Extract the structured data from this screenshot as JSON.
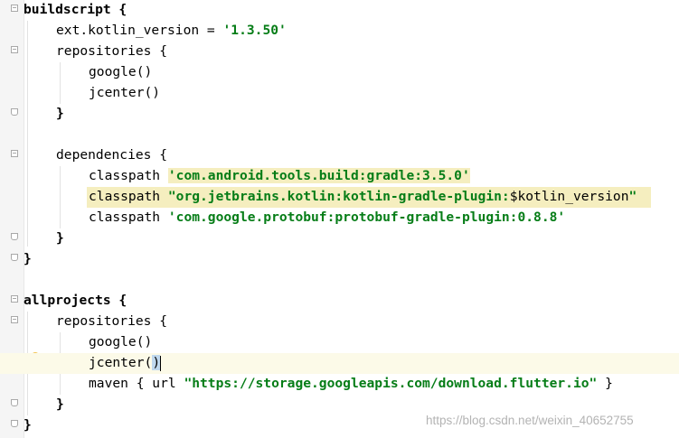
{
  "editor": {
    "lines": [
      {
        "tokens": [
          {
            "t": "buildscript {",
            "c": "kw"
          }
        ]
      },
      {
        "tokens": [
          {
            "t": "ext.kotlin_version = ",
            "c": ""
          },
          {
            "t": "'1.3.50'",
            "c": "str"
          }
        ]
      },
      {
        "tokens": [
          {
            "t": "repositories {",
            "c": ""
          }
        ]
      },
      {
        "tokens": [
          {
            "t": "google()",
            "c": ""
          }
        ]
      },
      {
        "tokens": [
          {
            "t": "jcenter()",
            "c": ""
          }
        ]
      },
      {
        "tokens": [
          {
            "t": "}",
            "c": "kw"
          }
        ]
      },
      {
        "tokens": []
      },
      {
        "tokens": [
          {
            "t": "dependencies {",
            "c": ""
          }
        ]
      },
      {
        "tokens": [
          {
            "t": "classpath ",
            "c": ""
          },
          {
            "t": "'com.android.tools.build:gradle:3.5.0'",
            "c": "str hl"
          }
        ]
      },
      {
        "tokens": [
          {
            "t": "classpath ",
            "c": ""
          },
          {
            "t": "\"org.jetbrains.kotlin:kotlin-gradle-plugin:",
            "c": "str"
          },
          {
            "t": "$kotlin_version",
            "c": ""
          },
          {
            "t": "\"",
            "c": "str"
          }
        ]
      },
      {
        "tokens": [
          {
            "t": "classpath ",
            "c": ""
          },
          {
            "t": "'com.google.protobuf:protobuf-gradle-plugin:0.8.8'",
            "c": "str"
          }
        ]
      },
      {
        "tokens": [
          {
            "t": "}",
            "c": "kw"
          }
        ]
      },
      {
        "tokens": [
          {
            "t": "}",
            "c": "kw"
          }
        ]
      },
      {
        "tokens": []
      },
      {
        "tokens": [
          {
            "t": "allprojects {",
            "c": "kw"
          }
        ]
      },
      {
        "tokens": [
          {
            "t": "repositories {",
            "c": ""
          }
        ]
      },
      {
        "tokens": [
          {
            "t": "google()",
            "c": ""
          }
        ]
      },
      {
        "tokens": [
          {
            "t": "jcenter",
            "c": ""
          },
          {
            "t": "(",
            "c": ""
          },
          {
            "t": ")",
            "c": "brace-hl"
          }
        ]
      },
      {
        "tokens": [
          {
            "t": "maven { url ",
            "c": ""
          },
          {
            "t": "\"https://storage.googleapis.com/download.flutter.io\"",
            "c": "str"
          },
          {
            "t": " }",
            "c": ""
          }
        ]
      },
      {
        "tokens": [
          {
            "t": "}",
            "c": "kw"
          }
        ]
      },
      {
        "tokens": [
          {
            "t": "}",
            "c": "kw"
          }
        ]
      }
    ]
  },
  "watermark": "https://blog.csdn.net/weixin_40652755"
}
